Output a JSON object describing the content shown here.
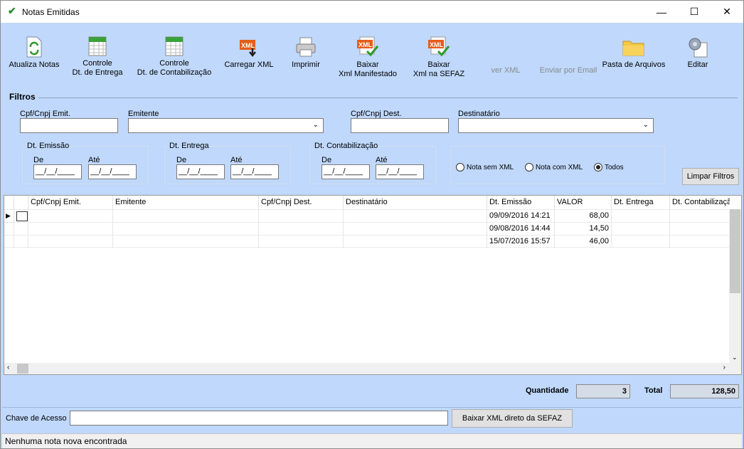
{
  "window": {
    "title": "Notas Emitidas",
    "controls": {
      "minimize": "—",
      "maximize": "☐",
      "close": "✕"
    }
  },
  "toolbar": {
    "atualiza": {
      "line1": "Atualiza Notas",
      "line2": ""
    },
    "controle_entrega": {
      "line1": "Controle",
      "line2": "Dt. de Entrega"
    },
    "controle_contab": {
      "line1": "Controle",
      "line2": "Dt. de Contabilização"
    },
    "carregar": {
      "line1": "Carregar XML",
      "line2": ""
    },
    "imprimir": {
      "line1": "Imprimir",
      "line2": ""
    },
    "baixar_manif": {
      "line1": "Baixar",
      "line2": "Xml Manifestado"
    },
    "baixar_sefaz": {
      "line1": "Baixar",
      "line2": "Xml na SEFAZ"
    },
    "ver_xml": {
      "line1": "ver XML",
      "line2": ""
    },
    "enviar_email": {
      "line1": "Enviar por Email",
      "line2": ""
    },
    "pasta": {
      "line1": "Pasta de Arquivos",
      "line2": ""
    },
    "editar": {
      "line1": "Editar",
      "line2": ""
    }
  },
  "filtros": {
    "title": "Filtros",
    "cpf_emit_label": "Cpf/Cnpj Emit.",
    "emitente_label": "Emitente",
    "cpf_dest_label": "Cpf/Cnpj Dest.",
    "destinatario_label": "Destinatário",
    "dt_emissao": "Dt. Emissão",
    "dt_entrega": "Dt. Entrega",
    "dt_contab": "Dt. Contabilização",
    "de": "De",
    "ate": "Até",
    "date_mask": "__/__/____",
    "radio_sem": "Nota sem XML",
    "radio_com": "Nota com XML",
    "radio_todos": "Todos",
    "limpar": "Limpar Filtros"
  },
  "grid": {
    "columns": [
      "Cpf/Cnpj Emit.",
      "Emitente",
      "Cpf/Cnpj Dest.",
      "Destinatário",
      "Dt. Emissão",
      "VALOR",
      "Dt. Entrega",
      "Dt. Contabilização"
    ],
    "rows": [
      {
        "dt_emissao": "09/09/2016 14:21",
        "valor": "68,00"
      },
      {
        "dt_emissao": "09/08/2016 14:44",
        "valor": "14,50"
      },
      {
        "dt_emissao": "15/07/2016 15:57",
        "valor": "46,00"
      }
    ]
  },
  "totals": {
    "quantidade_label": "Quantidade",
    "quantidade": "3",
    "total_label": "Total",
    "total": "128,50"
  },
  "chave": {
    "label": "Chave de Acesso",
    "value": "",
    "button": "Baixar XML direto da SEFAZ"
  },
  "status": "Nenhuma nota nova encontrada",
  "colors": {
    "background": "#bfd8fb",
    "title_bar": "#ffffff",
    "status_bar": "#f0f0f0"
  }
}
